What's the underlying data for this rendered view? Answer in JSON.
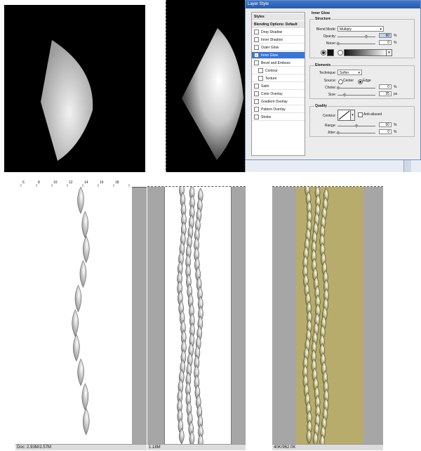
{
  "dialog": {
    "title": "Layer Style",
    "styles_list": [
      {
        "label": "Styles",
        "type": "head"
      },
      {
        "label": "Blending Options: Default",
        "type": "head"
      },
      {
        "label": "Drop Shadow",
        "checked": false
      },
      {
        "label": "Inner Shadow",
        "checked": false
      },
      {
        "label": "Outer Glow",
        "checked": false
      },
      {
        "label": "Inner Glow",
        "checked": true,
        "selected": true
      },
      {
        "label": "Bevel and Emboss",
        "checked": false
      },
      {
        "label": "Contour",
        "checked": false,
        "indent": true
      },
      {
        "label": "Texture",
        "checked": false,
        "indent": true
      },
      {
        "label": "Satin",
        "checked": false
      },
      {
        "label": "Color Overlay",
        "checked": false
      },
      {
        "label": "Gradient Overlay",
        "checked": false
      },
      {
        "label": "Pattern Overlay",
        "checked": false
      },
      {
        "label": "Stroke",
        "checked": false
      }
    ],
    "section_title": "Inner Glow",
    "structure": {
      "title": "Structure",
      "blend_mode_label": "Blend Mode:",
      "blend_mode_value": "Multiply",
      "opacity_label": "Opacity:",
      "opacity_value": "90",
      "noise_label": "Noise:",
      "noise_value": "0",
      "percent": "%"
    },
    "elements": {
      "title": "Elements",
      "technique_label": "Technique:",
      "technique_value": "Softer",
      "source_label": "Source:",
      "source_center": "Center",
      "source_edge": "Edge",
      "choke_label": "Choke:",
      "choke_value": "0",
      "size_label": "Size:",
      "size_value": "35",
      "px": "px",
      "percent": "%"
    },
    "quality": {
      "title": "Quality",
      "contour_label": "Contour:",
      "anti_aliased_label": "Anti-aliased",
      "range_label": "Range:",
      "range_value": "50",
      "jitter_label": "Jitter:",
      "jitter_value": "0",
      "percent": "%"
    }
  },
  "ruler": {
    "ticks": [
      "6",
      "8",
      "10",
      "12",
      "14",
      "16",
      "18"
    ]
  },
  "status": {
    "doc1": "Doc: 2.93M/2.57M",
    "doc2": "1.18M",
    "doc3": "40K/962.0K"
  },
  "colors": {
    "gold": "#b8ac6c",
    "selection": "#3875d7"
  }
}
